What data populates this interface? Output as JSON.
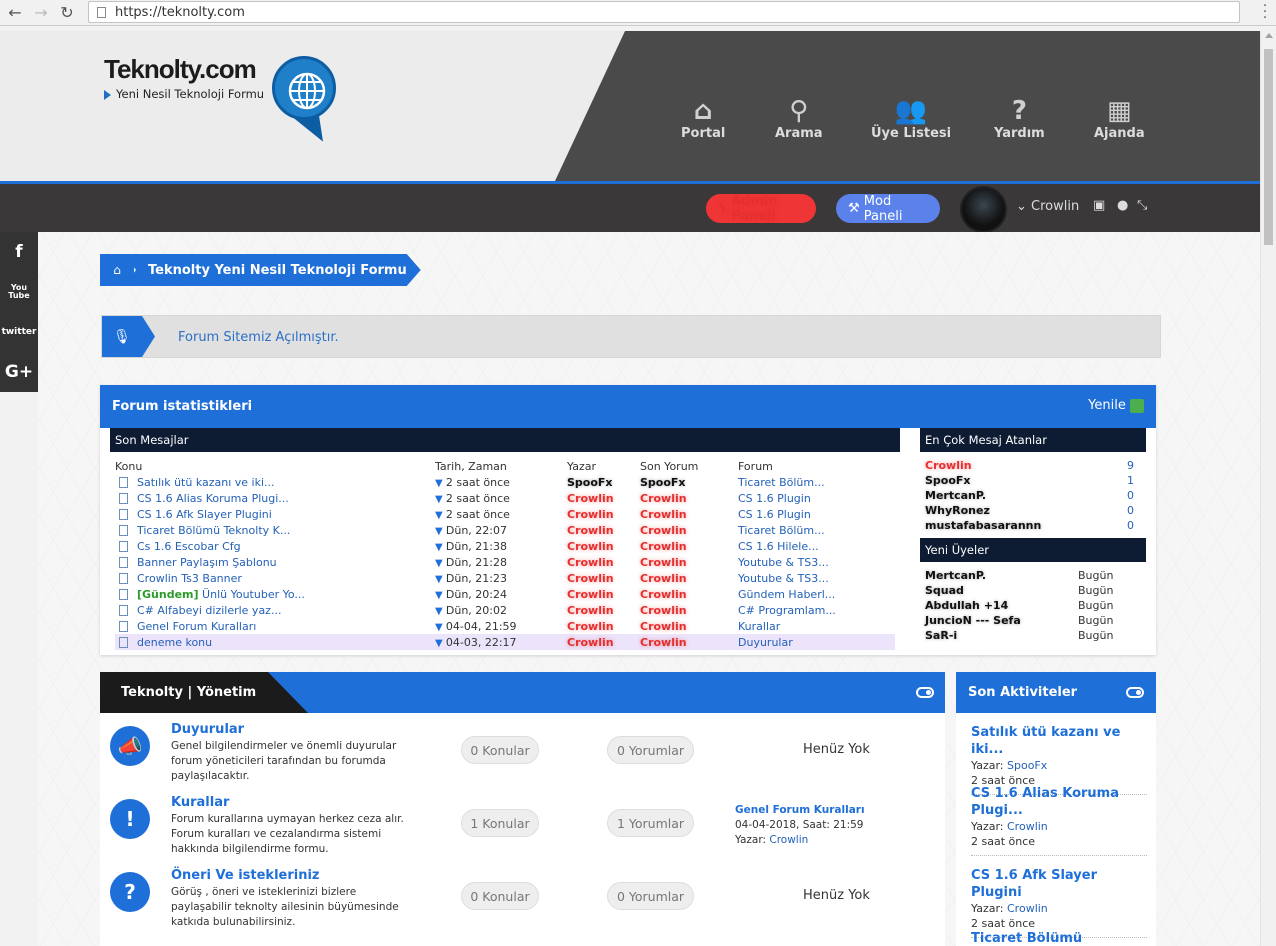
{
  "browser": {
    "url": "https://teknolty.com"
  },
  "header": {
    "logo_title": "Teknolty.com",
    "logo_subtitle": "Yeni Nesil Teknoloji Formu",
    "nav": [
      {
        "label": "Portal",
        "icon": "home-icon"
      },
      {
        "label": "Arama",
        "icon": "search-icon"
      },
      {
        "label": "Üye Listesi",
        "icon": "users-icon"
      },
      {
        "label": "Yardım",
        "icon": "help-icon"
      },
      {
        "label": "Ajanda",
        "icon": "calendar-icon"
      }
    ]
  },
  "userbar": {
    "admin_label": "Admin Paneli",
    "mod_label": "Mod Paneli",
    "username": "Crowlin"
  },
  "social": [
    "f",
    "You Tube",
    "twitter",
    "G+"
  ],
  "breadcrumb": {
    "label": "Teknolty Yeni Nesil Teknoloji Formu"
  },
  "announcement": {
    "text": "Forum Sitemiz Açılmıştır."
  },
  "stats": {
    "title": "Forum istatistikleri",
    "refresh_label": "Yenile",
    "recent_title": "Son Mesajlar",
    "columns": [
      "Konu",
      "Tarih, Zaman",
      "Yazar",
      "Son Yorum",
      "Forum"
    ],
    "rows": [
      {
        "prefix": "",
        "topic": "Satılık ütü kazanı ve iki...",
        "date": "2 saat önce",
        "author": "SpooFx",
        "author_style": "blk",
        "last": "SpooFx",
        "last_style": "blk",
        "forum": "Ticaret Bölüm..."
      },
      {
        "prefix": "",
        "topic": "CS 1.6 Alias Koruma Plugi...",
        "date": "2 saat önce",
        "author": "Crowlin",
        "author_style": "red",
        "last": "Crowlin",
        "last_style": "red",
        "forum": "CS 1.6 Plugin"
      },
      {
        "prefix": "",
        "topic": "CS 1.6 Afk Slayer Plugini",
        "date": "2 saat önce",
        "author": "Crowlin",
        "author_style": "red",
        "last": "Crowlin",
        "last_style": "red",
        "forum": "CS 1.6 Plugin"
      },
      {
        "prefix": "",
        "topic": "Ticaret Bölümü Teknolty K...",
        "date": "Dün, 22:07",
        "author": "Crowlin",
        "author_style": "red",
        "last": "Crowlin",
        "last_style": "red",
        "forum": "Ticaret Bölüm..."
      },
      {
        "prefix": "",
        "topic": "Cs 1.6 Escobar Cfg",
        "date": "Dün, 21:38",
        "author": "Crowlin",
        "author_style": "red",
        "last": "Crowlin",
        "last_style": "red",
        "forum": "CS 1.6 Hilele..."
      },
      {
        "prefix": "",
        "topic": "Banner Paylaşım Şablonu",
        "date": "Dün, 21:28",
        "author": "Crowlin",
        "author_style": "red",
        "last": "Crowlin",
        "last_style": "red",
        "forum": "Youtube & TS3..."
      },
      {
        "prefix": "",
        "topic": "Crowlin Ts3 Banner",
        "date": "Dün, 21:23",
        "author": "Crowlin",
        "author_style": "red",
        "last": "Crowlin",
        "last_style": "red",
        "forum": "Youtube & TS3..."
      },
      {
        "prefix": "[Gündem]",
        "topic": "Ünlü Youtuber Yo...",
        "date": "Dün, 20:24",
        "author": "Crowlin",
        "author_style": "red",
        "last": "Crowlin",
        "last_style": "red",
        "forum": "Gündem Haberl..."
      },
      {
        "prefix": "",
        "topic": "C# Alfabeyi dizilerle yaz...",
        "date": "Dün, 20:02",
        "author": "Crowlin",
        "author_style": "red",
        "last": "Crowlin",
        "last_style": "red",
        "forum": "C# Programlam..."
      },
      {
        "prefix": "",
        "topic": "Genel Forum Kuralları",
        "date": "04-04, 21:59",
        "author": "Crowlin",
        "author_style": "red",
        "last": "Crowlin",
        "last_style": "red",
        "forum": "Kurallar"
      },
      {
        "prefix": "",
        "topic": "deneme konu",
        "date": "04-03, 22:17",
        "author": "Crowlin",
        "author_style": "red",
        "last": "Crowlin",
        "last_style": "red",
        "forum": "Duyurular",
        "highlight": true
      }
    ],
    "top_posters_title": "En Çok Mesaj Atanlar",
    "top_posters": [
      {
        "name": "Crowlin",
        "style": "red",
        "count": "9"
      },
      {
        "name": "SpooFx",
        "style": "blk",
        "count": "1"
      },
      {
        "name": "MertcanP.",
        "style": "blk",
        "count": "0"
      },
      {
        "name": "WhyRonez",
        "style": "blk",
        "count": "0"
      },
      {
        "name": "mustafabasarannn",
        "style": "blk",
        "count": "0"
      }
    ],
    "new_members_title": "Yeni Üyeler",
    "new_members": [
      {
        "name": "MertcanP.",
        "when": "Bugün"
      },
      {
        "name": "Squad",
        "when": "Bugün"
      },
      {
        "name": "Abdullah +14",
        "when": "Bugün"
      },
      {
        "name": "JuncioN --- Sefa",
        "when": "Bugün"
      },
      {
        "name": "SaR-i",
        "when": "Bugün"
      }
    ]
  },
  "management": {
    "title": "Teknolty | Yönetim",
    "forums": [
      {
        "title": "Duyurular",
        "desc": "Genel bilgilendirmeler ve önemli duyurular forum yöneticileri tarafından bu forumda paylaşılacaktır.",
        "topics": "0 Konular",
        "posts": "0 Yorumlar",
        "last": "Henüz Yok",
        "icon": "megaphone-icon"
      },
      {
        "title": "Kurallar",
        "desc": "Forum kurallarına uymayan herkez ceza alır. Forum kuralları ve cezalandırma sistemi hakkında bilgilendirme formu.",
        "topics": "1 Konular",
        "posts": "1 Yorumlar",
        "last_title": "Genel Forum Kuralları",
        "last_date": "04-04-2018, Saat: 21:59",
        "last_by_label": "Yazar:",
        "last_by": "Crowlin",
        "icon": "exclamation-icon"
      },
      {
        "title": "Öneri Ve istekleriniz",
        "desc": "Görüş , öneri ve isteklerinizi bizlere paylaşabilir teknolty ailesinin büyümesinde katkıda bulunabilirsiniz.",
        "topics": "0 Konular",
        "posts": "0 Yorumlar",
        "last": "Henüz Yok",
        "icon": "question-icon"
      }
    ]
  },
  "activity": {
    "title": "Son Aktiviteler",
    "items": [
      {
        "title": "Satılık ütü kazanı ve iki...",
        "by_label": "Yazar:",
        "by": "SpooFx",
        "when": "2 saat önce"
      },
      {
        "title": "CS 1.6 Alias Koruma Plugi...",
        "by_label": "Yazar:",
        "by": "Crowlin",
        "when": "2 saat önce"
      },
      {
        "title": "CS 1.6 Afk Slayer Plugini",
        "by_label": "Yazar:",
        "by": "Crowlin",
        "when": "2 saat önce"
      },
      {
        "title": "Ticaret Bölümü Teknolty",
        "by_label": "",
        "by": "",
        "when": ""
      }
    ]
  }
}
